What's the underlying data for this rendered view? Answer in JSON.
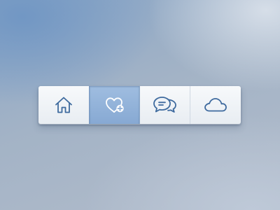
{
  "tabbar": {
    "tabs": [
      {
        "icon": "home-icon",
        "active": false
      },
      {
        "icon": "heart-plus-icon",
        "active": true
      },
      {
        "icon": "chat-bubbles-icon",
        "active": false
      },
      {
        "icon": "cloud-icon",
        "active": false
      }
    ]
  },
  "colors": {
    "icon_stroke": "#3e6a9e",
    "icon_stroke_active": "#ffffff",
    "active_tab": "#93b3d9",
    "tab_background": "#eef2f6"
  }
}
